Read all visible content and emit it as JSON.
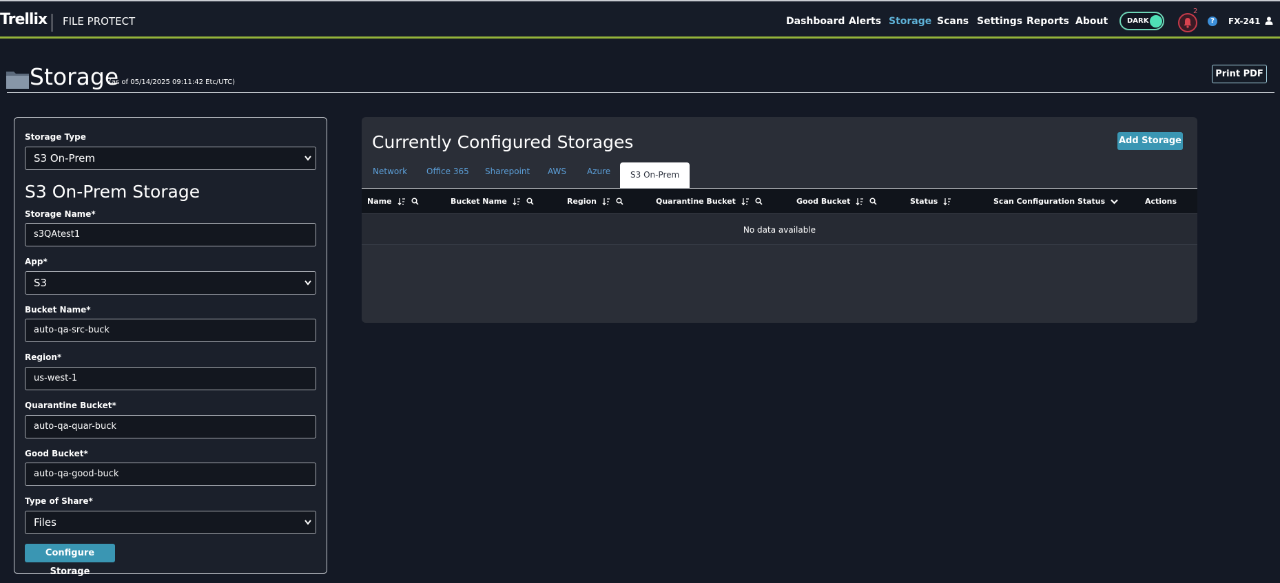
{
  "header": {
    "logo": "Trellix",
    "product": "FILE PROTECT",
    "nav": [
      {
        "label": "Dashboard",
        "active": false
      },
      {
        "label": "Alerts",
        "active": false
      },
      {
        "label": "Storage",
        "active": true
      },
      {
        "label": "Scans",
        "active": false
      },
      {
        "label": "Settings",
        "active": false
      },
      {
        "label": "Reports",
        "active": false
      },
      {
        "label": "About",
        "active": false
      }
    ],
    "theme_label": "DARK",
    "notification_count": "2",
    "help_glyph": "?",
    "user_id": "FX-241",
    "accent_color": "#94b33a"
  },
  "page": {
    "title": "Storage",
    "as_of": "(as of 05/14/2025 09:11:42 Etc/UTC)",
    "print_label": "Print PDF"
  },
  "form": {
    "storage_type_label": "Storage Type",
    "storage_type_value": "S3 On-Prem",
    "heading": "S3 On-Prem Storage",
    "storage_name_label": "Storage Name*",
    "storage_name_value": "s3QAtest1",
    "app_label": "App*",
    "app_value": "S3",
    "bucket_name_label": "Bucket Name*",
    "bucket_name_value": "auto-qa-src-buck",
    "region_label": "Region*",
    "region_value": "us-west-1",
    "quarantine_label": "Quarantine Bucket*",
    "quarantine_value": "auto-qa-quar-buck",
    "good_bucket_label": "Good Bucket*",
    "good_bucket_value": "auto-qa-good-buck",
    "share_type_label": "Type of Share*",
    "share_type_value": "Files",
    "configure_label": "Configure Storage"
  },
  "table": {
    "title": "Currently Configured Storages",
    "add_label": "Add Storage",
    "tabs": [
      {
        "label": "Network",
        "active": false
      },
      {
        "label": "Office 365",
        "active": false
      },
      {
        "label": "Sharepoint",
        "active": false
      },
      {
        "label": "AWS",
        "active": false
      },
      {
        "label": "Azure",
        "active": false
      },
      {
        "label": "S3 On-Prem",
        "active": true
      }
    ],
    "columns": [
      "Name",
      "Bucket Name",
      "Region",
      "Quarantine Bucket",
      "Good Bucket",
      "Status",
      "Scan Configuration Status",
      "Actions"
    ],
    "empty_text": "No data available"
  }
}
